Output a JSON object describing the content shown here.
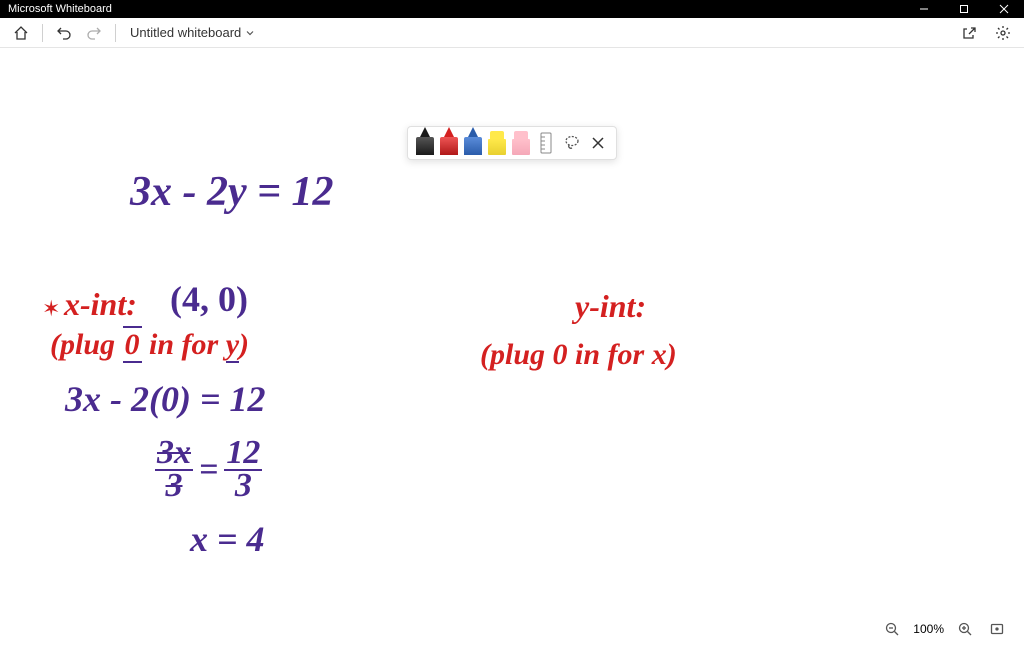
{
  "app": {
    "title": "Microsoft Whiteboard"
  },
  "toolbar": {
    "file_title": "Untitled whiteboard"
  },
  "zoom": {
    "level": "100%"
  },
  "handwriting": {
    "equation": "3x - 2y = 12",
    "xint_label": "x-int:",
    "xint_value": "(4, 0)",
    "xint_hint": "(plug 0 in for y)",
    "step1": "3x - 2(0) = 12",
    "step2_num": "3x",
    "step2_eq": "=",
    "step2_val": "12",
    "step2_denom": "3",
    "step3": "x = 4",
    "yint_label": "y-int:",
    "yint_hint": "(plug 0 in for x)"
  }
}
